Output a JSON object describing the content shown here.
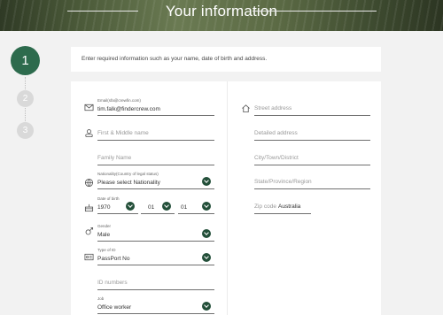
{
  "header": {
    "title": "Your information"
  },
  "steps": [
    {
      "label": "1",
      "state": "active"
    },
    {
      "label": "2",
      "state": "inactive"
    },
    {
      "label": "3",
      "state": "inactive"
    }
  ],
  "intro": {
    "text": "Enter required information such as your name, date of birth and address."
  },
  "form": {
    "email": {
      "label": "Email(sfa@crewfin.com)",
      "value": "tim.falk@findercrew.com",
      "icon": "mail-icon"
    },
    "first_middle_name": {
      "placeholder": "First & Middle name",
      "icon": "person-icon"
    },
    "family_name": {
      "placeholder": "Family Name"
    },
    "nationality": {
      "label": "Nationality(Country of legal status)",
      "value": "Please select Nationality",
      "icon": "globe-icon"
    },
    "birth": {
      "label": "Date of birth",
      "year": "1970",
      "month": "01",
      "day": "01",
      "icon": "cake-icon"
    },
    "gender": {
      "label": "Gender",
      "value": "Male",
      "icon": "gender-icon"
    },
    "id_type": {
      "label": "Type of ID",
      "value": "PassPort No",
      "icon": "id-card-icon"
    },
    "id_number": {
      "placeholder": "ID numbers"
    },
    "job": {
      "label": "Job",
      "value": "Office worker"
    },
    "address": {
      "street": {
        "placeholder": "Street address",
        "icon": "home-icon"
      },
      "detailed": {
        "placeholder": "Detailed address"
      },
      "city": {
        "placeholder": "City/Town/District"
      },
      "state": {
        "placeholder": "State/Province/Region"
      },
      "zip": {
        "placeholder": "Zip code"
      },
      "country": "Australia"
    }
  },
  "colors": {
    "accent": "#2d6b4d",
    "chevron": "#234f39",
    "background": "#f2f2f2"
  }
}
